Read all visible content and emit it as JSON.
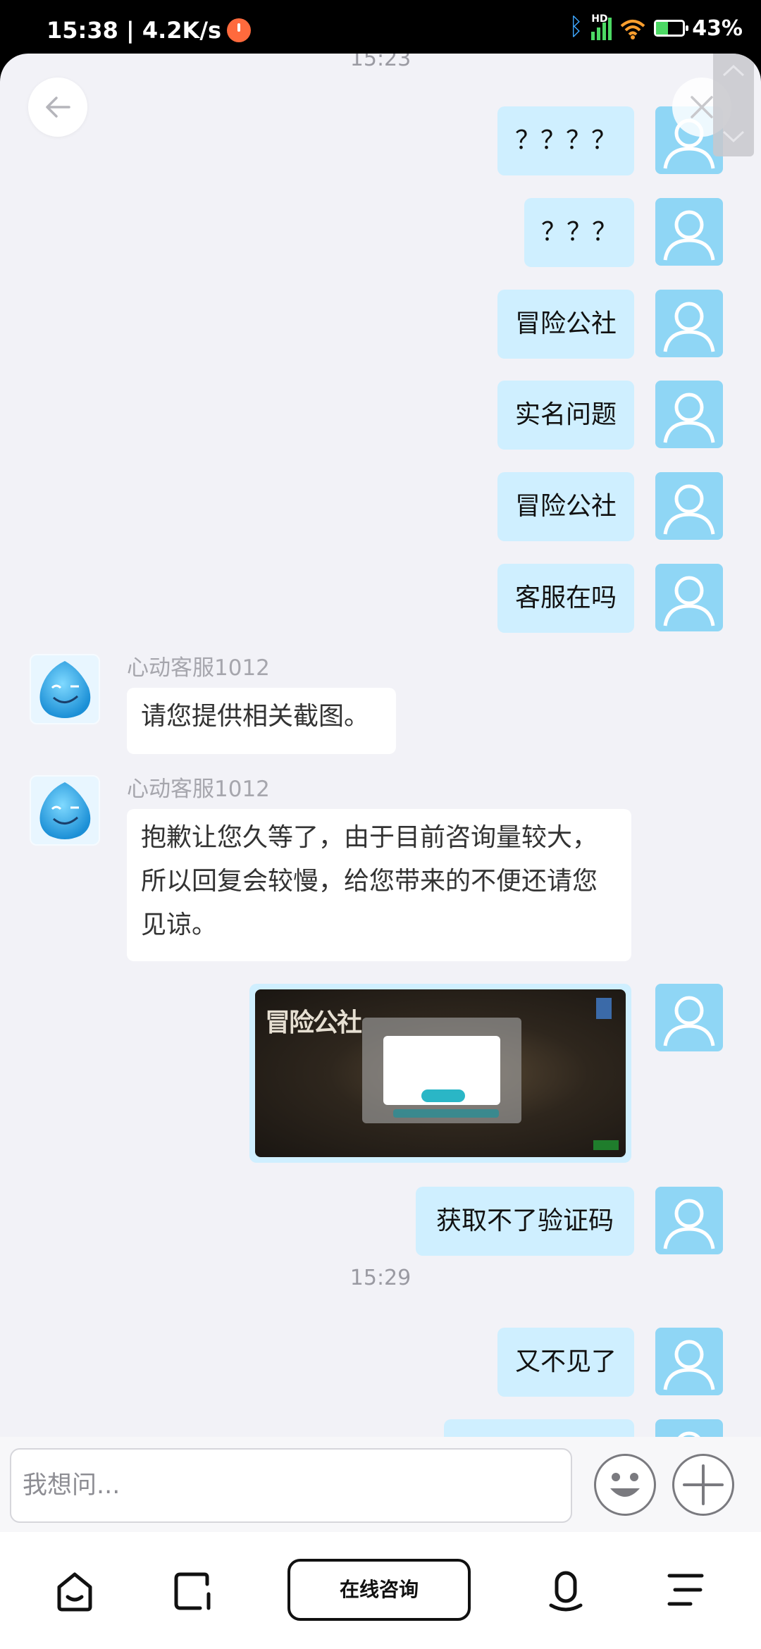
{
  "status_bar": {
    "time_speed": "15:38 | 4.2K/s",
    "hd_label": "HD",
    "battery_percent": "43%",
    "battery_level": 0.43
  },
  "chat": {
    "timestamps": [
      "15:23",
      "15:29"
    ],
    "outgoing": [
      {
        "text": "？？？？"
      },
      {
        "text": "？？？"
      },
      {
        "text": "冒险公社"
      },
      {
        "text": "实名问题"
      },
      {
        "text": "冒险公社"
      },
      {
        "text": "客服在吗"
      },
      {
        "text": "获取不了验证码"
      },
      {
        "text": "又不见了"
      },
      {
        "text": ""
      }
    ],
    "incoming": [
      {
        "sender": "心动客服1012",
        "text": "请您提供相关截图。"
      },
      {
        "sender": "心动客服1012",
        "text": "抱歉让您久等了，由于目前咨询量较大，所以回复会较慢，给您带来的不便还请您见谅。"
      }
    ],
    "image_message": {
      "logo_text": "冒险公社"
    }
  },
  "input": {
    "placeholder": "我想问..."
  },
  "nav": {
    "consult_label": "在线咨询"
  },
  "icons": {
    "back": "arrow-left-icon",
    "close": "close-icon",
    "emoji": "smiley-icon",
    "plus": "plus-icon",
    "home": "home-icon",
    "recent": "recent-apps-icon",
    "mic": "microphone-icon",
    "menu": "menu-icon"
  },
  "colors": {
    "outgoing_bubble": "#cfefff",
    "user_avatar": "#8fd6f5",
    "background": "#f2f2f7"
  }
}
